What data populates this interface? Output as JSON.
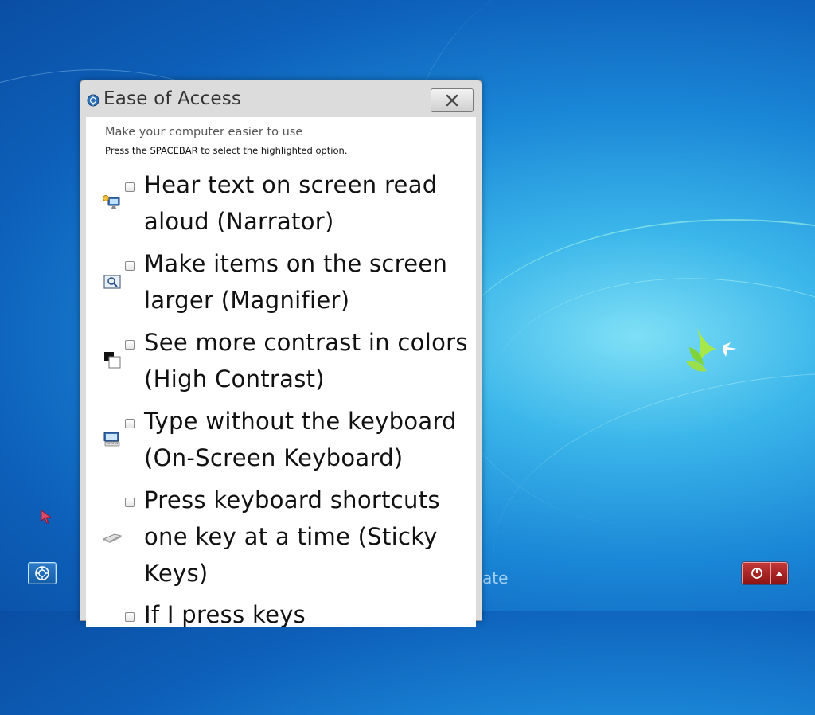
{
  "window": {
    "title": "Ease of Access",
    "close_label": "close"
  },
  "dialog": {
    "heading": "Make your computer easier to use",
    "instruction": "Press the SPACEBAR to select the highlighted option.",
    "options": [
      {
        "label": "Hear text on screen read aloud (Narrator)",
        "icon": "narrator-icon",
        "checked": false
      },
      {
        "label": "Make items on the screen larger (Magnifier)",
        "icon": "magnifier-icon",
        "checked": false
      },
      {
        "label": "See more contrast in colors (High Contrast)",
        "icon": "high-contrast-icon",
        "checked": false
      },
      {
        "label": "Type without the keyboard (On-Screen Keyboard)",
        "icon": "keyboard-icon",
        "checked": false
      },
      {
        "label": "Press keyboard shortcuts one key at a time (Sticky Keys)",
        "icon": "sticky-keys-icon",
        "checked": false
      },
      {
        "label": "If I press keys",
        "icon": "",
        "checked": false
      }
    ]
  },
  "desktop": {
    "brand_fragment": "ate"
  },
  "colors": {
    "accent": "#1a86d6",
    "power": "#b02020"
  }
}
